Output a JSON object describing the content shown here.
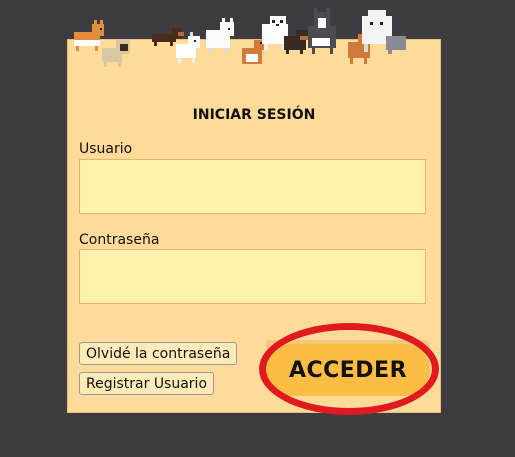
{
  "login": {
    "title": "INICIAR SESIÓN",
    "username_label": "Usuario",
    "username_value": "",
    "password_label": "Contraseña",
    "password_value": "",
    "forgot_label": "Olvidé la contraseña",
    "register_label": "Registrar Usuario",
    "submit_label": "ACCEDER"
  },
  "colors": {
    "background": "#3c3c41",
    "card": "#ffdb9a",
    "field": "#fff1ac",
    "submit": "#fbbd43",
    "highlight": "#e01a1f"
  },
  "icons": {
    "banner": "pixel-dogs-banner"
  }
}
